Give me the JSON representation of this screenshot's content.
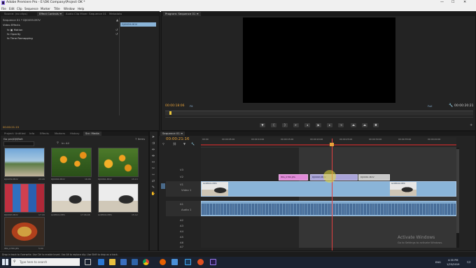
{
  "window": {
    "title": "Adobe Premiere Pro - E:\\OK Company\\Project OK *",
    "min": "—",
    "max": "☐",
    "close": "✕"
  },
  "menu": [
    "File",
    "Edit",
    "Clip",
    "Sequence",
    "Marker",
    "Title",
    "Window",
    "Help"
  ],
  "effect_controls": {
    "tabs": [
      "Source: (no clips)",
      "Effect Controls ≡",
      "Audio Clip Mixer: Sequence 01",
      "Metadata"
    ],
    "sequence_label": "Sequence 01 * DJI0059.MOV",
    "clip_label": "DJI0059.MOV",
    "section": "Video Effects",
    "effects": [
      "fx ▣ Motion",
      "fx Opacity",
      "fx Time Remapping"
    ],
    "timecode": "00:00:21:15"
  },
  "program": {
    "tab": "Program: Sequence 01 ≡",
    "timecode_left": "00:00:18:06",
    "fit": "Fit",
    "quality": "Full",
    "timecode_right": "00:00:20:21"
  },
  "project": {
    "tabs": [
      "Project: Untitled",
      "Info",
      "Effects",
      "Markers",
      "History",
      "Src: Media"
    ],
    "bin_name": "Go pro\\Dji\\Bolt",
    "items_count": "7 Items",
    "search_placeholder": "In: All",
    "clips": [
      {
        "name": "DJI0059.MOV",
        "dur": "23:18"
      },
      {
        "name": "DJI0060.MOV",
        "dur": "16:06"
      },
      {
        "name": "DJI0061.MOV",
        "dur": "15:13"
      },
      {
        "name": "DJI0063.MOV",
        "dur": "17:18"
      },
      {
        "name": "GOPR01.MP4",
        "dur": "17:06:08"
      },
      {
        "name": "GOPR02.MP4",
        "dur": "15:12"
      },
      {
        "name": "IMG_0780.JPG",
        "dur": "5:00"
      }
    ]
  },
  "timeline": {
    "tab": "Sequence 01 ≡",
    "timecode": "00:00:21:16",
    "ruler": [
      "00:00",
      "00:00:05:00",
      "00:00:10:00",
      "00:00:15:00",
      "00:00:20:00",
      "00:00:25:00",
      "00:00:30:00",
      "00:00:35:00",
      "00:00:40:00"
    ],
    "video_tracks": [
      "V3",
      "V2",
      "V1"
    ],
    "audio_tracks": [
      "A1",
      "A2",
      "A3",
      "A4",
      "A5",
      "A6",
      "A7"
    ],
    "track_names": {
      "v1": "Video 1",
      "a1": "Audio 1"
    },
    "clip_labels": {
      "pink": "IMG_0780.JPG",
      "lavender": "DJI0063.MOV",
      "gray": "DJI0061.MOV",
      "v1a": "GOPR01.MP4",
      "v1b": "GOPR02.MP4"
    }
  },
  "status_bar": {
    "hint": "Drop in track to Overwrite. Use Ctrl to enable Insert. Use Alt to replace clip. Use Shift to drop as a track."
  },
  "watermark": {
    "line1": "Activate Windows",
    "line2": "Go to Settings to activate Windows."
  },
  "taskbar": {
    "search_placeholder": "Type here to search",
    "time": "4:35 PM",
    "date": "1/23/2019",
    "lang": "ENG"
  },
  "colors": {
    "accent_blue": "#8ab4d8",
    "playhead": "#e04040",
    "timecode": "#e8a33a",
    "pink_clip": "#e08ad8",
    "lavender_clip": "#a9a4d8"
  }
}
